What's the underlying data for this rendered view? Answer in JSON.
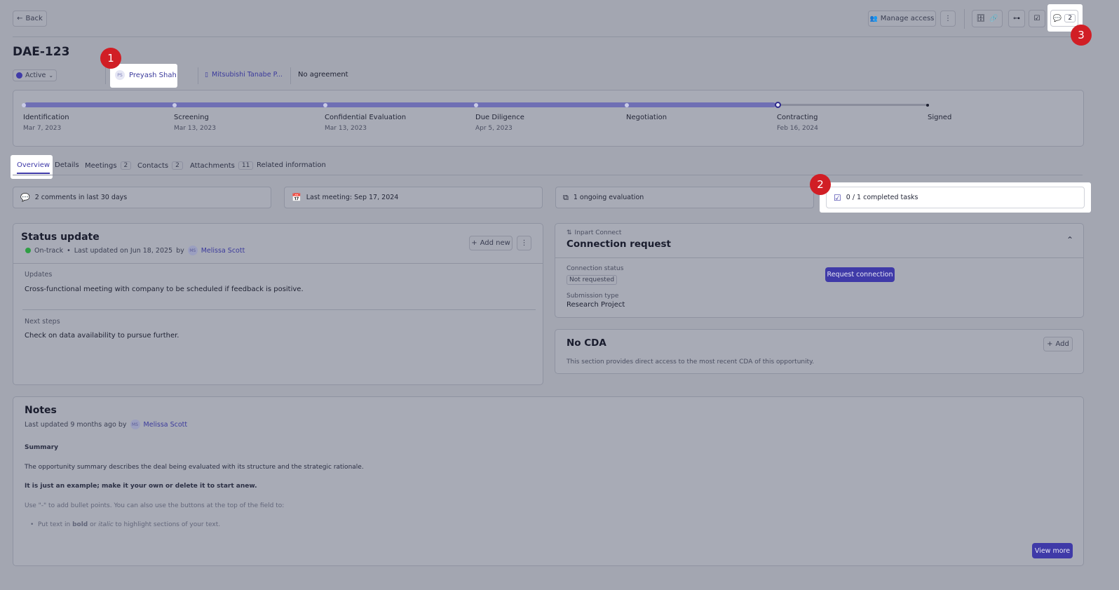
{
  "toolbar": {
    "back_label": "Back",
    "manage_access_label": "Manage access",
    "comments_count": "2"
  },
  "header": {
    "title": "DAE-123",
    "status": "Active",
    "owner_initials": "PS",
    "owner_name": "Preyash Shah",
    "company": "Mitsubishi Tanabe P...",
    "agreement": "No agreement"
  },
  "pipeline": {
    "progress_fraction": 0.83,
    "stages": [
      {
        "name": "Identification",
        "date": "Mar 7, 2023"
      },
      {
        "name": "Screening",
        "date": "Mar 13, 2023"
      },
      {
        "name": "Confidential Evaluation",
        "date": "Mar 13, 2023"
      },
      {
        "name": "Due Diligence",
        "date": "Apr 5, 2023"
      },
      {
        "name": "Negotiation",
        "date": ""
      },
      {
        "name": "Contracting",
        "date": "Feb 16, 2024"
      },
      {
        "name": "Signed",
        "date": ""
      }
    ]
  },
  "tabs": [
    {
      "label": "Overview",
      "count": ""
    },
    {
      "label": "Details",
      "count": ""
    },
    {
      "label": "Meetings",
      "count": "2"
    },
    {
      "label": "Contacts",
      "count": "2"
    },
    {
      "label": "Attachments",
      "count": "11"
    },
    {
      "label": "Related information",
      "count": ""
    }
  ],
  "stats": {
    "comments": "2 comments in last 30 days",
    "last_meeting": "Last meeting: Sep 17, 2024",
    "evaluations": "1 ongoing evaluation",
    "tasks": "0 / 1 completed tasks"
  },
  "status_update": {
    "title": "Status update",
    "state": "On-track",
    "updated_text": "Last updated on Jun 18, 2025",
    "by": "by",
    "author_initials": "MS",
    "author": "Melissa Scott",
    "add_new_label": "Add new",
    "updates_label": "Updates",
    "updates_text": "Cross-functional meeting with company to be scheduled if feedback is positive.",
    "next_steps_label": "Next steps",
    "next_steps_text": "Check on data availability to pursue further."
  },
  "connection": {
    "source": "Inpart Connect",
    "title": "Connection request",
    "status_label": "Connection status",
    "status_value": "Not requested",
    "request_button": "Request connection",
    "submission_label": "Submission type",
    "submission_value": "Research Project"
  },
  "cda": {
    "title": "No CDA",
    "add_label": "Add",
    "description": "This section provides direct access to the most recent CDA of this opportunity."
  },
  "notes": {
    "title": "Notes",
    "updated_text": "Last updated 9 months ago by",
    "author_initials": "MS",
    "author": "Melissa Scott",
    "summary_heading": "Summary",
    "paragraph1": "The opportunity summary describes the deal being evaluated with its structure and the strategic rationale.",
    "paragraph2": "It is just an example; make it your own or delete it to start anew.",
    "paragraph3": "Use \"-\" to add bullet points. You can also use the buttons at the top of the field to:",
    "bullet_pre": "Put text in ",
    "bullet_bold": "bold",
    "bullet_mid": " or ",
    "bullet_italic": "italic",
    "bullet_post": " to highlight sections of your text.",
    "view_more_label": "View more"
  },
  "markers": [
    "1",
    "2",
    "3"
  ],
  "colors": {
    "accent": "#3f3aa8",
    "highlight": "#ffffff",
    "marker": "#d11e25",
    "on_track": "#2f9e44"
  }
}
